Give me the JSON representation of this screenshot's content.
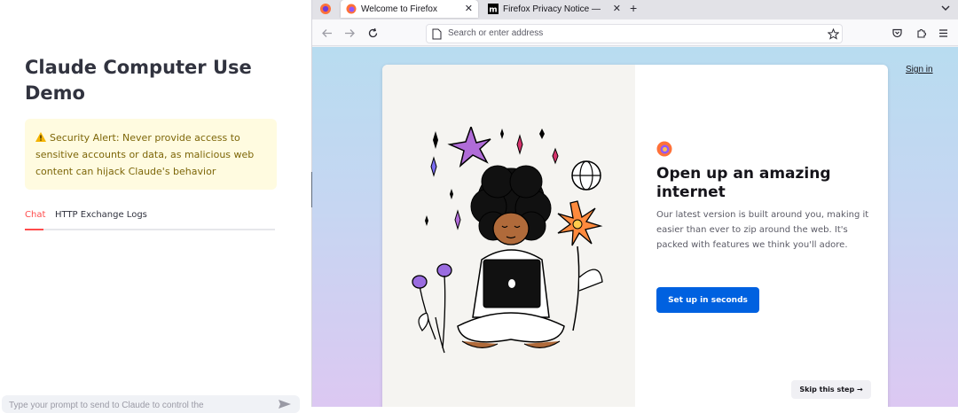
{
  "sidebar": {
    "title": "Claude Computer Use Demo",
    "alert": "Security Alert: Never provide access to sensitive accounts or data, as malicious web content can hijack Claude's behavior",
    "tabs": [
      {
        "label": "Chat",
        "active": true
      },
      {
        "label": "HTTP Exchange Logs",
        "active": false
      }
    ],
    "chat_input_placeholder": "Type your prompt to send to Claude to control the"
  },
  "browser": {
    "tabs": [
      {
        "title": "Welcome to Firefox",
        "active": true,
        "icon": "firefox-icon"
      },
      {
        "title": "Firefox Privacy Notice —",
        "active": false,
        "icon": "mozilla-m-icon"
      }
    ],
    "address_placeholder": "Search or enter address"
  },
  "page": {
    "sign_in": "Sign in",
    "headline": "Open up an amazing internet",
    "subtext": "Our latest version is built around you, making it easier than ever to zip around the web. It's packed with features we think you'll adore.",
    "setup_button": "Set up in seconds",
    "skip_button": "Skip this step →"
  },
  "colors": {
    "accent_red": "#ff4b4b",
    "alert_bg": "#fffbe0",
    "primary_blue": "#0061e0"
  }
}
